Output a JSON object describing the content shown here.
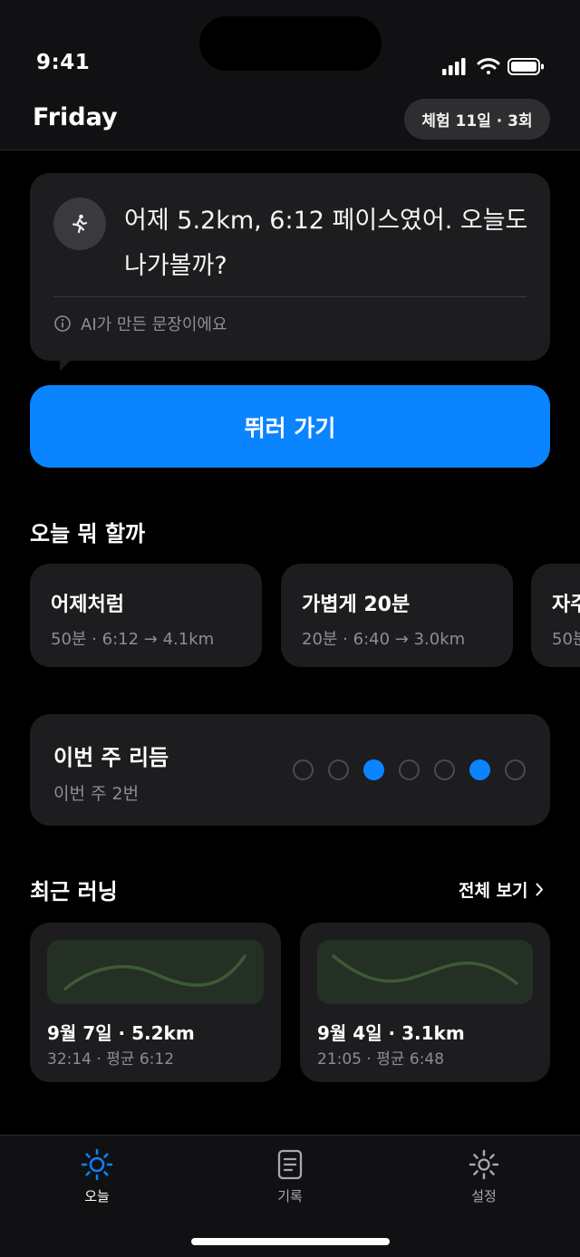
{
  "status_bar": {
    "time": "9:41"
  },
  "header": {
    "title": "Friday",
    "trial_badge": "체험 11일 · 3회"
  },
  "coach_bubble": {
    "avatar_icon": "runner-icon",
    "message": "어제 5.2km, 6:12 페이스였어. 오늘도 나가볼까?",
    "ai_note": "AI가 만든 문장이에요"
  },
  "primary_button": {
    "label": "뛰러 가기",
    "color": "#0a84ff"
  },
  "today_plans": {
    "title": "오늘 뭐 할까",
    "items": [
      {
        "name": "어제처럼",
        "meta": "50분 · 6:12 → 4.1km"
      },
      {
        "name": "가볍게 20분",
        "meta": "20분 · 6:40 → 3.0km"
      },
      {
        "name": "자주",
        "meta": "50분"
      }
    ]
  },
  "weekly_rhythm": {
    "title": "이번 주 리듬",
    "subtitle": "이번 주 2번",
    "days": [
      false,
      false,
      true,
      false,
      false,
      true,
      false
    ]
  },
  "recent_runs": {
    "title": "최근 러닝",
    "see_all": "전체 보기",
    "items": [
      {
        "title": "9월 7일 · 5.2km",
        "meta": "32:14 · 평균 6:12"
      },
      {
        "title": "9월 4일 · 3.1km",
        "meta": "21:05 · 평균 6:48"
      }
    ]
  },
  "tab_bar": {
    "items": [
      {
        "label": "오늘",
        "icon": "sun-icon",
        "active": true
      },
      {
        "label": "기록",
        "icon": "document-icon",
        "active": false
      },
      {
        "label": "설정",
        "icon": "gear-icon",
        "active": false
      }
    ]
  }
}
